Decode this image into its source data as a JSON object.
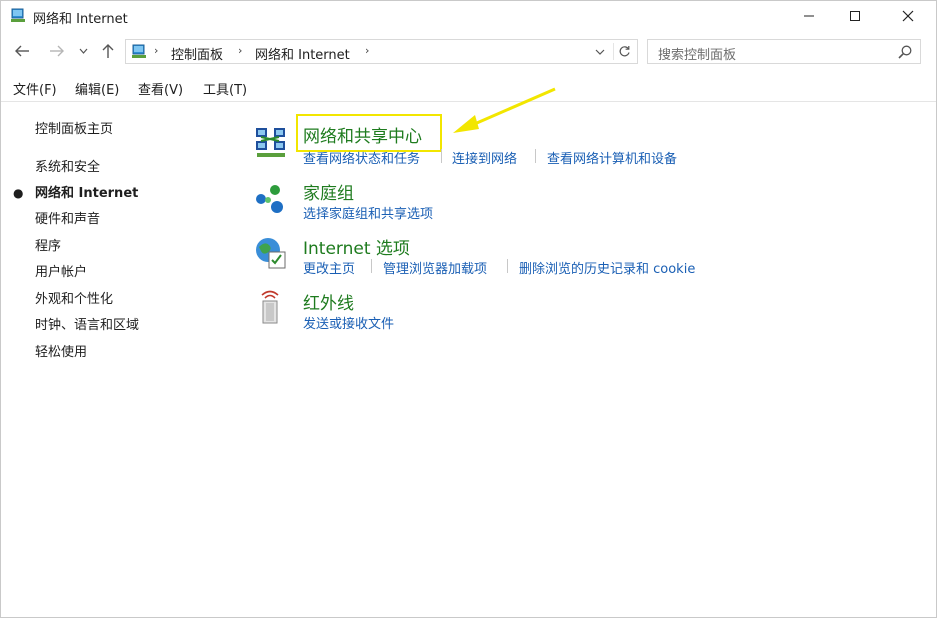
{
  "window": {
    "title": "网络和 Internet",
    "controls": [
      "minimize",
      "maximize",
      "close"
    ]
  },
  "address": {
    "breadcrumb": [
      "控制面板",
      "网络和 Internet"
    ],
    "search_placeholder": "搜索控制面板"
  },
  "menu": [
    "文件(F)",
    "编辑(E)",
    "查看(V)",
    "工具(T)"
  ],
  "sidebar": {
    "home": "控制面板主页",
    "items": [
      {
        "label": "系统和安全",
        "active": false
      },
      {
        "label": "网络和 Internet",
        "active": true
      },
      {
        "label": "硬件和声音",
        "active": false
      },
      {
        "label": "程序",
        "active": false
      },
      {
        "label": "用户帐户",
        "active": false
      },
      {
        "label": "外观和个性化",
        "active": false
      },
      {
        "label": "时钟、语言和区域",
        "active": false
      },
      {
        "label": "轻松使用",
        "active": false
      }
    ]
  },
  "categories": [
    {
      "title": "网络和共享中心",
      "icon": "network-sharing-icon",
      "links": [
        "查看网络状态和任务",
        "连接到网络",
        "查看网络计算机和设备"
      ],
      "highlighted": true
    },
    {
      "title": "家庭组",
      "icon": "homegroup-icon",
      "links": [
        "选择家庭组和共享选项"
      ]
    },
    {
      "title": "Internet 选项",
      "icon": "internet-options-icon",
      "links": [
        "更改主页",
        "管理浏览器加载项",
        "删除浏览的历史记录和 cookie"
      ]
    },
    {
      "title": "红外线",
      "icon": "infrared-icon",
      "links": [
        "发送或接收文件"
      ]
    }
  ],
  "colors": {
    "category_title": "#1e7b1e",
    "link": "#1a5fb4",
    "highlight": "#f2e600"
  }
}
